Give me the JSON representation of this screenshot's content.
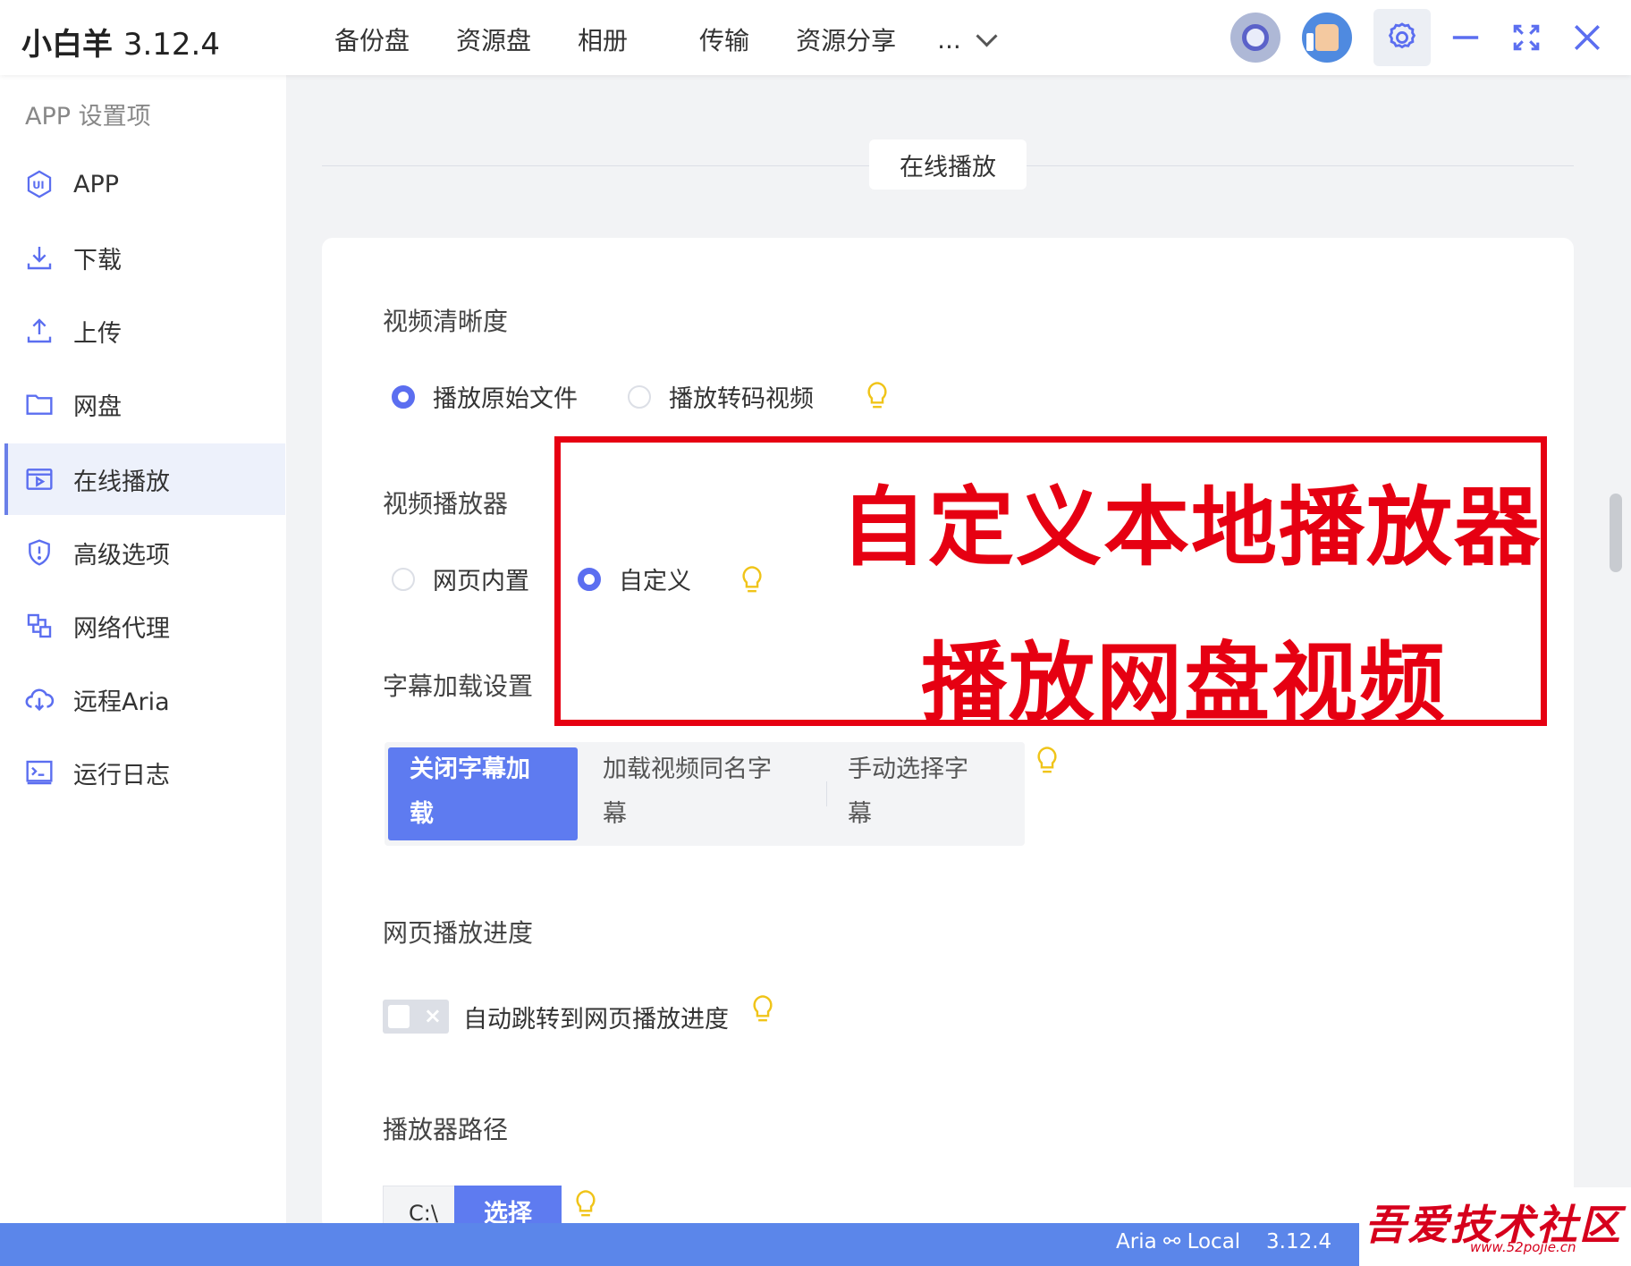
{
  "app": {
    "name": "小白羊",
    "version": "3.12.4"
  },
  "nav": {
    "items": [
      "备份盘",
      "资源盘",
      "相册",
      "传输",
      "资源分享"
    ],
    "more": "..."
  },
  "sidebar": {
    "title": "APP 设置项",
    "items": [
      {
        "label": "APP",
        "icon": "ui-badge-icon"
      },
      {
        "label": "下载",
        "icon": "download-icon"
      },
      {
        "label": "上传",
        "icon": "upload-icon"
      },
      {
        "label": "网盘",
        "icon": "folder-icon"
      },
      {
        "label": "在线播放",
        "icon": "video-player-icon",
        "active": true
      },
      {
        "label": "高级选项",
        "icon": "shield-icon"
      },
      {
        "label": "网络代理",
        "icon": "network-icon"
      },
      {
        "label": "远程Aria",
        "icon": "cloud-icon"
      },
      {
        "label": "运行日志",
        "icon": "terminal-icon"
      }
    ]
  },
  "section": {
    "title": "在线播放"
  },
  "settings": {
    "clarity": {
      "label": "视频清晰度",
      "options": [
        "播放原始文件",
        "播放转码视频"
      ],
      "selected": "播放原始文件"
    },
    "player": {
      "label": "视频播放器",
      "options": [
        "网页内置",
        "自定义"
      ],
      "selected": "自定义"
    },
    "subtitle": {
      "label": "字幕加载设置",
      "options": [
        [
          "关闭字幕加",
          "载"
        ],
        [
          "加载视频同名字",
          "幕"
        ],
        [
          "手动选择字",
          "幕"
        ]
      ],
      "selected": 0
    },
    "progress": {
      "label": "网页播放进度",
      "switch_label": "自动跳转到网页播放进度",
      "on": false
    },
    "path": {
      "label": "播放器路径",
      "value": "C:\\",
      "button": "选择"
    }
  },
  "annotation": {
    "line1": "自定义本地播放器",
    "line2": "播放网盘视频",
    "color": "#e60012"
  },
  "status": {
    "aria": "Aria ⚯ Local",
    "version": "3.12.4"
  },
  "watermark": {
    "main": "吾爱技术社区",
    "sub": "www.52pojie.cn"
  },
  "colors": {
    "accent": "#5e7bf0",
    "statusbar": "#5b86ea",
    "bulb": "#f0c419"
  }
}
